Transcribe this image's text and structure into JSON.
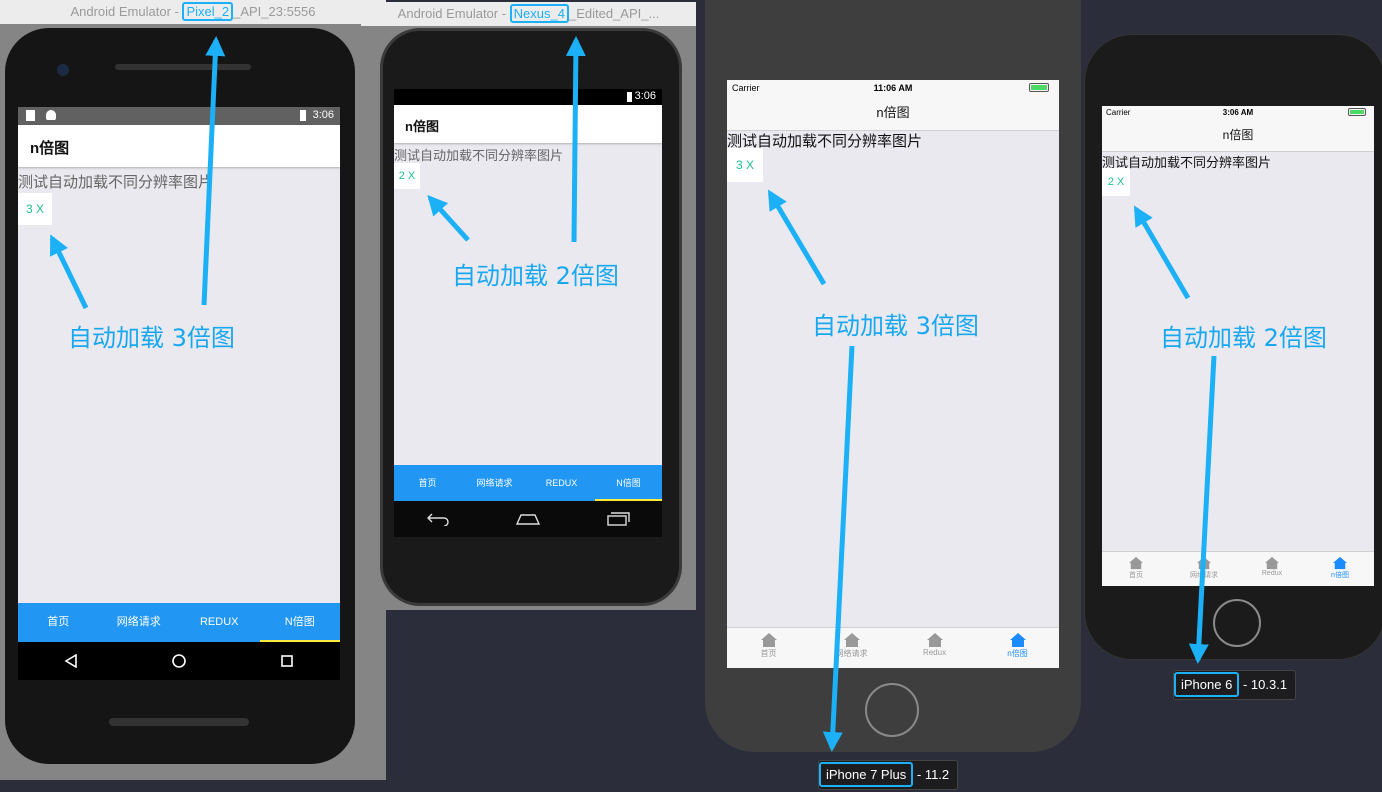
{
  "pixel2": {
    "title_prefix": "Android Emulator - ",
    "title_highlight": "Pixel_2",
    "title_suffix": "_API_23:5556",
    "status_time": "3:06",
    "toolbar_title": "n倍图",
    "body_text": "测试自动加载不同分辨率图片",
    "badge": "3 X",
    "tabs": [
      "首页",
      "网络请求",
      "REDUX",
      "N倍图"
    ],
    "caption": "自动加载 3倍图"
  },
  "nexus4": {
    "title_prefix": "Android Emulator - ",
    "title_highlight": "Nexus_4",
    "title_suffix": "_Edited_API_...",
    "status_time": "3:06",
    "toolbar_title": "n倍图",
    "body_text": "测试自动加载不同分辨率图片",
    "badge": "2 X",
    "tabs": [
      "首页",
      "网络请求",
      "REDUX",
      "N倍图"
    ],
    "caption": "自动加载 2倍图"
  },
  "iphone7plus": {
    "carrier": "Carrier",
    "time": "11:06 AM",
    "nav_title": "n倍图",
    "body_text": "测试自动加载不同分辨率图片",
    "badge": "3 X",
    "tabs": [
      "首页",
      "网络请求",
      "Redux",
      "n倍图"
    ],
    "caption": "自动加载 3倍图",
    "device_name": "iPhone 7 Plus",
    "version": "11.2"
  },
  "iphone6": {
    "carrier": "Carrier",
    "time": "3:06 AM",
    "nav_title": "n倍图",
    "body_text": "测试自动加载不同分辨率图片",
    "badge": "2 X",
    "tabs": [
      "首页",
      "网络请求",
      "Redux",
      "n倍图"
    ],
    "caption": "自动加载 2倍图",
    "device_name": "iPhone 6",
    "version": "10.3.1"
  },
  "colors": {
    "annotation": "#1cb0f6",
    "android_tab_bar": "#2196f3",
    "ios_tab_active": "#1a8cff",
    "badge_text": "#1fbf8f"
  }
}
